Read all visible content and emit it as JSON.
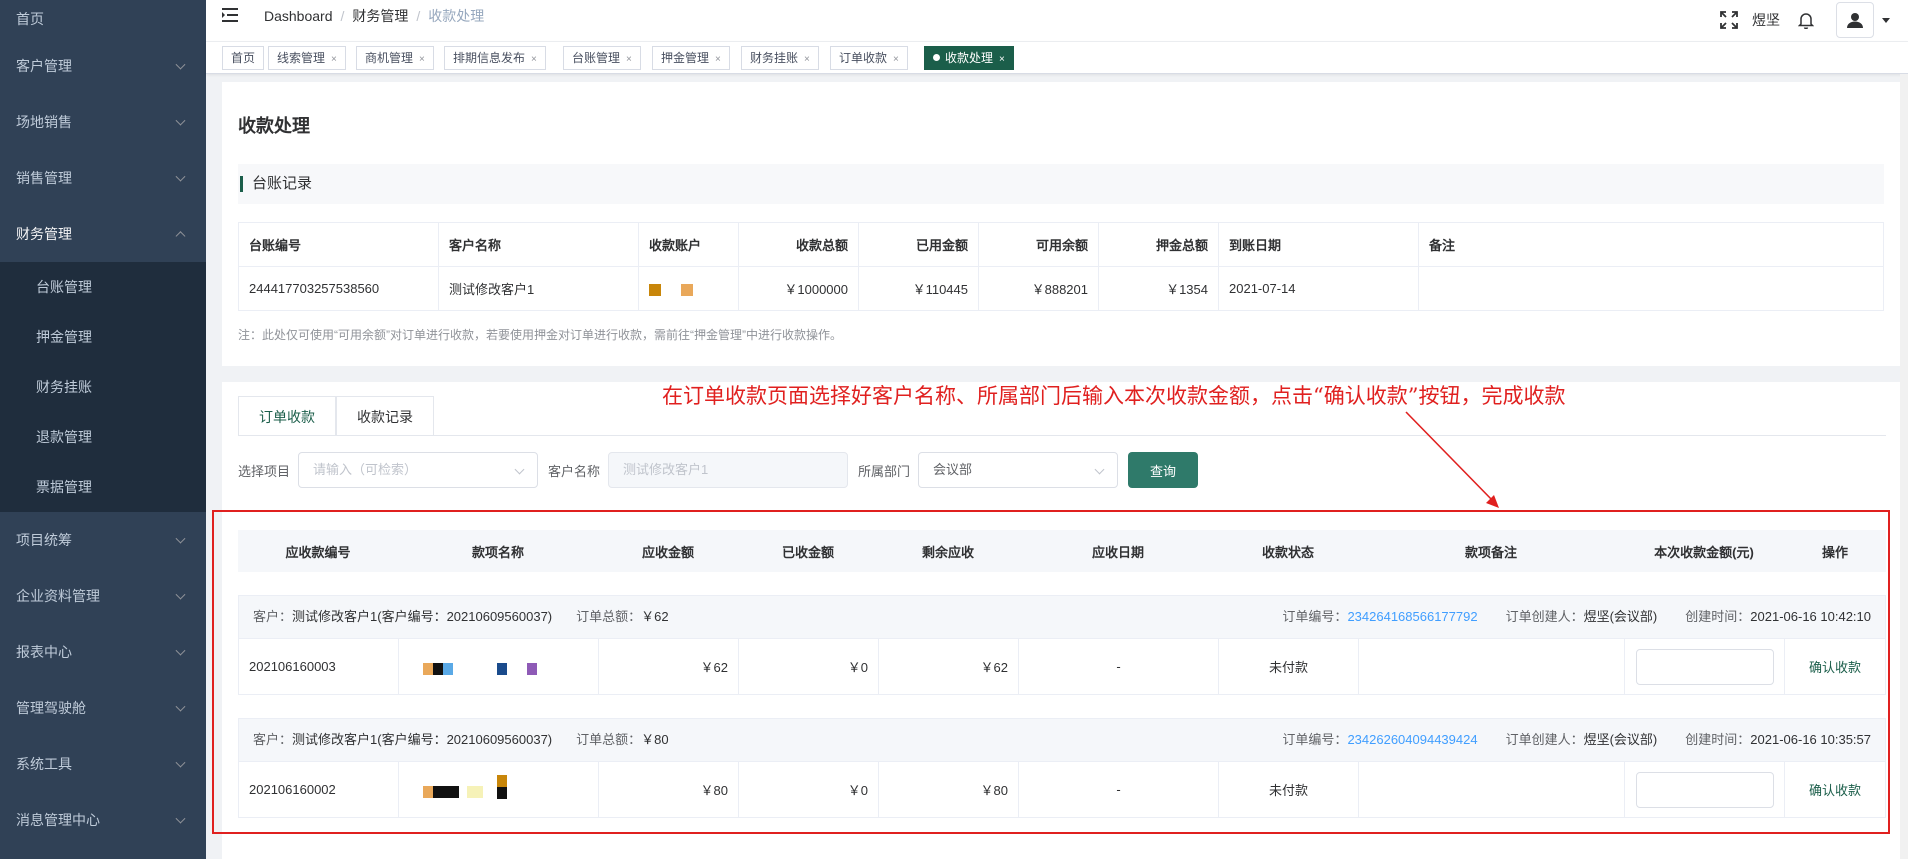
{
  "sidebar": {
    "items": [
      {
        "label": "首页"
      },
      {
        "label": "客户管理"
      },
      {
        "label": "场地销售"
      },
      {
        "label": "销售管理"
      },
      {
        "label": "财务管理"
      },
      {
        "label": "项目统筹"
      },
      {
        "label": "企业资料管理"
      },
      {
        "label": "报表中心"
      },
      {
        "label": "管理驾驶舱"
      },
      {
        "label": "系统工具"
      },
      {
        "label": "消息管理中心"
      }
    ],
    "finance_sub": [
      {
        "label": "台账管理"
      },
      {
        "label": "押金管理"
      },
      {
        "label": "财务挂账"
      },
      {
        "label": "退款管理"
      },
      {
        "label": "票据管理"
      }
    ]
  },
  "breadcrumb": {
    "home": "Dashboard",
    "parent": "财务管理",
    "current": "收款处理",
    "sep": "/"
  },
  "navbar": {
    "user": "煜坚"
  },
  "tags": [
    {
      "label": "首页"
    },
    {
      "label": "线索管理",
      "close": "×"
    },
    {
      "label": "商机管理",
      "close": "×"
    },
    {
      "label": "排期信息发布",
      "close": "×"
    },
    {
      "label": "台账管理",
      "close": "×"
    },
    {
      "label": "押金管理",
      "close": "×"
    },
    {
      "label": "财务挂账",
      "close": "×"
    },
    {
      "label": "订单收款",
      "close": "×"
    },
    {
      "label": "收款处理",
      "close": "×"
    }
  ],
  "page": {
    "title": "收款处理",
    "section": "台账记录"
  },
  "ledger": {
    "headers": [
      "台账编号",
      "客户名称",
      "收款账户",
      "收款总额",
      "已用金额",
      "可用余额",
      "押金总额",
      "到账日期",
      "备注"
    ],
    "row": {
      "id": "244417703257538560",
      "customer": "测试修改客户1",
      "total": "￥1000000",
      "used": "￥110445",
      "available": "￥888201",
      "deposit": "￥1354",
      "date": "2021-07-14",
      "remark": ""
    },
    "note": "注：此处仅可使用“可用余额”对订单进行收款，若要使用押金对订单进行收款，需前往“押金管理”中进行收款操作。"
  },
  "tabs": [
    {
      "label": "订单收款"
    },
    {
      "label": "收款记录"
    }
  ],
  "filter": {
    "project_label": "选择项目",
    "project_placeholder": "请输入（可检索）",
    "customer_label": "客户名称",
    "customer_value": "测试修改客户1",
    "dept_label": "所属部门",
    "dept_value": "会议部",
    "query_label": "查询"
  },
  "annotation": "在订单收款页面选择好客户名称、所属部门后输入本次收款金额，点击“确认收款”按钮，完成收款",
  "orders": {
    "headers": [
      "应收款编号",
      "款项名称",
      "应收金额",
      "已收金额",
      "剩余应收",
      "应收日期",
      "收款状态",
      "款项备注",
      "本次收款金额(元)",
      "操作"
    ],
    "groups": [
      {
        "customer_label": "客户：",
        "customer": "测试修改客户1(客户编号：20210609560037)",
        "total_label": "订单总额：",
        "total": "￥62",
        "order_no_label": "订单编号：",
        "order_no": "234264168566177792",
        "creator_label": "订单创建人：",
        "creator": "煜坚(会议部)",
        "created_label": "创建时间：",
        "created": "2021-06-16 10:42:10",
        "row": {
          "id": "202106160003",
          "due": "￥62",
          "received": "￥0",
          "remain": "￥62",
          "date": "-",
          "status": "未付款",
          "remark": "",
          "action": "确认收款"
        }
      },
      {
        "customer_label": "客户：",
        "customer": "测试修改客户1(客户编号：20210609560037)",
        "total_label": "订单总额：",
        "total": "￥80",
        "order_no_label": "订单编号：",
        "order_no": "234262604094439424",
        "creator_label": "订单创建人：",
        "creator": "煜坚(会议部)",
        "created_label": "创建时间：",
        "created": "2021-06-16 10:35:57",
        "row": {
          "id": "202106160002",
          "due": "￥80",
          "received": "￥0",
          "remain": "￥80",
          "date": "-",
          "status": "未付款",
          "remark": "",
          "action": "确认收款"
        }
      }
    ]
  },
  "colors": {
    "sidebar_bg": "#304156",
    "accent": "#1b5e4a",
    "button": "#2f7a6a",
    "annotation": "#e0201f",
    "link": "#409eff"
  },
  "icons": [
    "hamburger-icon",
    "fullscreen-icon",
    "bell-icon",
    "user-icon",
    "chevron-down-icon",
    "close-icon"
  ]
}
